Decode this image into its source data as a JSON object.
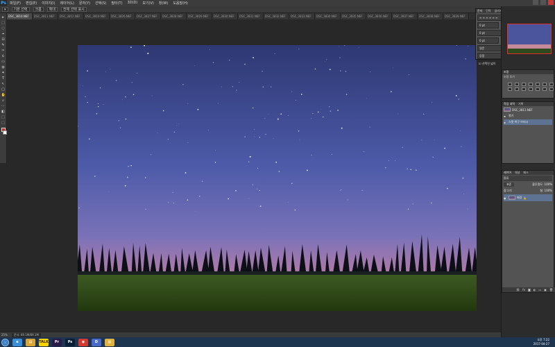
{
  "app": {
    "logo": "Ps"
  },
  "menu": [
    "파일(F)",
    "편집(E)",
    "이미지(I)",
    "레이어(L)",
    "문자(Y)",
    "선택(S)",
    "필터(T)",
    "3D(D)",
    "보기(V)",
    "창(W)",
    "도움말(H)"
  ],
  "options": {
    "items": [
      "기본 선택",
      "크롭",
      "확대",
      "전체 선택 표시"
    ]
  },
  "tabs": [
    "DSC_3810.NEF",
    "DSC_3811.NEF",
    "DSC_3812.NEF",
    "DSC_3819.NEF",
    "DSC_3826.NEF",
    "DSC_3827.NEF",
    "DSC_3828.NEF",
    "DSC_3829.NEF",
    "DSC_3830.NEF",
    "DSC_3831.NEF",
    "DSC_3832.NEF",
    "DSC_3833.NEF",
    "DSC_3834.NEF",
    "DSC_3835.NEF",
    "DSC_3836.NEF",
    "DSC_3837.NEF",
    "DSC_3838.NEF",
    "DSC_3839.NEF"
  ],
  "active_tab": 0,
  "tools": [
    "▸",
    "⬚",
    "◌",
    "⌖",
    "⊡",
    "✎",
    "✑",
    "⎀",
    "▭",
    "◍",
    "✦",
    "T",
    "↖",
    "▢",
    "✋",
    "⌕",
    "⋯",
    "◧",
    "⬚",
    "⬚"
  ],
  "float_panel": {
    "tabs": [
      "문자",
      "단락",
      "글리프"
    ],
    "fields": [
      "0 pt",
      "0 pt",
      "0 pt",
      "0 pt",
      "0 pt"
    ],
    "dropdowns": [
      "영문",
      "강함"
    ],
    "checkbox": "선택된 넓이"
  },
  "adjustments": {
    "tabs": [
      "조정"
    ],
    "subtitle": "조정 추가"
  },
  "history": {
    "tabs": [
      "작업 내역",
      "기록"
    ],
    "items": [
      {
        "label": "DSC_3811.NEF",
        "selected": false
      },
      {
        "label": "열기",
        "selected": false
      },
      {
        "label": "스팟 복구 브러시",
        "selected": true
      }
    ]
  },
  "layers": {
    "tabs": [
      "레이어",
      "채널",
      "패스"
    ],
    "filter_label": "종류",
    "blend": "표준",
    "opacity": "불투명도: 100%",
    "lock": "잠그기:",
    "fill": "칠: 100%",
    "items": [
      {
        "label": "배경",
        "selected": true
      }
    ]
  },
  "status": {
    "zoom": "25%",
    "doc": "문서: 69.1M/69.1M"
  },
  "taskbar": {
    "apps": [
      {
        "name": "ie",
        "glyph": "e",
        "color": "#3a8fd8"
      },
      {
        "name": "explorer",
        "glyph": "▤",
        "color": "#d9a633"
      },
      {
        "name": "kakao",
        "glyph": "TALK",
        "color": "#f7d600"
      },
      {
        "name": "premiere",
        "glyph": "Pr",
        "color": "#2a1a4a"
      },
      {
        "name": "photoshop",
        "glyph": "Ps",
        "color": "#0a1e36"
      },
      {
        "name": "chrome",
        "glyph": "◉",
        "color": "#d43b2e"
      },
      {
        "name": "daum",
        "glyph": "D",
        "color": "#4a6ac8"
      },
      {
        "name": "folder",
        "glyph": "▥",
        "color": "#e2b23e"
      }
    ],
    "time": "오후 7:22",
    "date": "2017-04-27"
  }
}
